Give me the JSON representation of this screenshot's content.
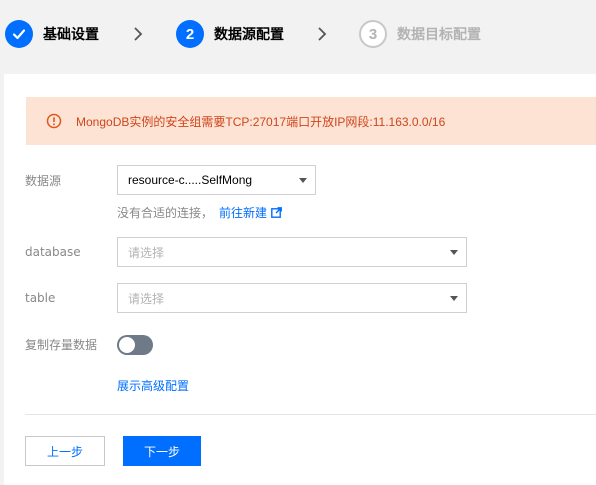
{
  "steps": [
    {
      "index": "1",
      "label": "基础设置",
      "state": "done"
    },
    {
      "index": "2",
      "label": "数据源配置",
      "state": "active"
    },
    {
      "index": "3",
      "label": "数据目标配置",
      "state": "pending"
    }
  ],
  "alert": {
    "text": "MongoDB实例的安全组需要TCP:27017端口开放IP网段:11.163.0.0/16"
  },
  "form": {
    "datasource": {
      "label": "数据源",
      "value": "resource-c.....SelfMong"
    },
    "hint": {
      "text": "没有合适的连接，",
      "link": "前往新建"
    },
    "database": {
      "label": "database",
      "placeholder": "请选择"
    },
    "table": {
      "label": "table",
      "placeholder": "请选择"
    },
    "copy_existing": {
      "label": "复制存量数据",
      "enabled": false
    },
    "advanced_link": "展示高级配置"
  },
  "buttons": {
    "prev": "上一步",
    "next": "下一步"
  },
  "colors": {
    "primary": "#006eff",
    "alert_bg": "#fce3d4",
    "alert_text": "#d0451c",
    "toggle_off": "#6e7a88"
  }
}
